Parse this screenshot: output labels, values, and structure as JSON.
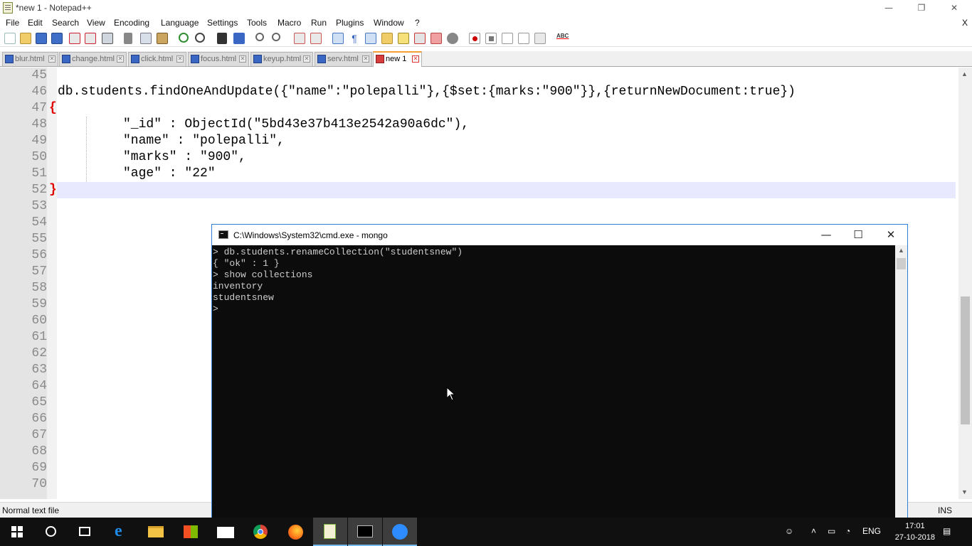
{
  "notepad": {
    "title": "*new 1 - Notepad++",
    "menu": [
      "File",
      "Edit",
      "Search",
      "View",
      "Encoding",
      "Language",
      "Settings",
      "Tools",
      "Macro",
      "Run",
      "Plugins",
      "Window",
      "?"
    ],
    "menu_close": "X",
    "tabs": [
      {
        "label": "blur.html"
      },
      {
        "label": "change.html"
      },
      {
        "label": "click.html"
      },
      {
        "label": "focus.html"
      },
      {
        "label": "keyup.html"
      },
      {
        "label": "serv.html"
      },
      {
        "label": "new 1"
      }
    ],
    "line_numbers": [
      "45",
      "46",
      "47",
      "48",
      "49",
      "50",
      "51",
      "52",
      "53",
      "54",
      "55",
      "56",
      "57",
      "58",
      "59",
      "60",
      "61",
      "62",
      "63",
      "64",
      "65",
      "66",
      "67",
      "68",
      "69",
      "70"
    ],
    "code": {
      "l46": "db.students.findOneAndUpdate({\"name\":\"polepalli\"},{$set:{marks:\"900\"}},{returnNewDocument:true})",
      "l47": "{",
      "l48": "\"_id\" : ObjectId(\"5bd43e37b413e2542a90a6dc\"),",
      "l49": "\"name\" : \"polepalli\",",
      "l50": "\"marks\" : \"900\",",
      "l51": "\"age\" : \"22\"",
      "l52": "}"
    },
    "status_left": "Normal text file",
    "status_right": "INS"
  },
  "cmd": {
    "title": "C:\\Windows\\System32\\cmd.exe - mongo",
    "lines": [
      "> db.students.renameCollection(\"studentsnew\")",
      "{ \"ok\" : 1 }",
      "> show collections",
      "inventory",
      "studentsnew",
      ">"
    ]
  },
  "taskbar": {
    "lang": "ENG",
    "time": "17:01",
    "date": "27-10-2018"
  }
}
